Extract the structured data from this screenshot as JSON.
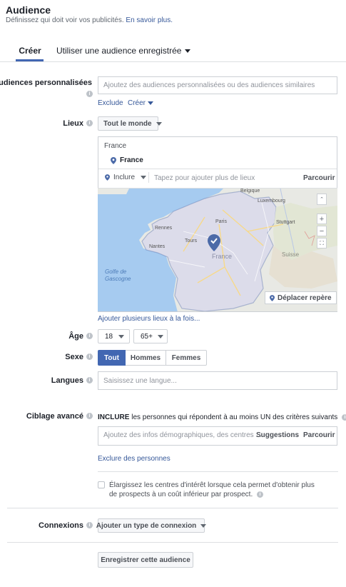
{
  "header": {
    "title": "Audience",
    "subtitle": "Définissez qui doit voir vos publicités.",
    "learn_more": "En savoir plus."
  },
  "tabs": [
    {
      "label": "Créer",
      "active": true
    },
    {
      "label": "Utiliser une audience enregistrée",
      "active": false
    }
  ],
  "custom_audiences": {
    "label": "Audiences personnalisées",
    "placeholder": "Ajoutez des audiences personnalisées ou des audiences similaires",
    "exclude": "Exclude",
    "create": "Créer"
  },
  "locations": {
    "label": "Lieux",
    "scope": "Tout le monde",
    "country_header": "France",
    "selected": "France",
    "include": "Inclure",
    "placeholder": "Tapez pour ajouter plus de lieux",
    "browse": "Parcourir",
    "move_pin": "Déplacer repère",
    "add_multiple": "Ajouter plusieurs lieux à la fois...",
    "map_labels": {
      "sea": "Golfe de\nGascogne",
      "country": "France",
      "city_paris": "Paris",
      "switzerland": "Suisse",
      "luxembourg": "Luxembourg",
      "stuttgart": "Stuttgart",
      "nantes": "Nantes",
      "tours": "Tours",
      "rennes": "Rennes",
      "belgique": "Belgique"
    }
  },
  "age": {
    "label": "Âge",
    "min": "18",
    "max": "65+",
    "dash": "-"
  },
  "gender": {
    "label": "Sexe",
    "options": [
      "Tout",
      "Hommes",
      "Femmes"
    ],
    "selected": "Tout"
  },
  "languages": {
    "label": "Langues",
    "placeholder": "Saisissez une langue..."
  },
  "detailed_targeting": {
    "label": "Ciblage avancé",
    "headline_bold": "INCLURE",
    "headline_rest": "les personnes qui répondent à au moins UN des critères suivants",
    "placeholder": "Ajoutez des infos démographiques, des centres ...",
    "suggestions": "Suggestions",
    "browse": "Parcourir",
    "exclude_people": "Exclure des personnes",
    "expand_text": "Élargissez les centres d'intérêt lorsque cela permet d'obtenir plus de prospects à un coût inférieur par prospect."
  },
  "connections": {
    "label": "Connexions",
    "button": "Ajouter un type de connexion"
  },
  "save_button": "Enregistrer cette audience",
  "colors": {
    "accent": "#4267b2",
    "link": "#365899",
    "water": "#a6cbf0",
    "land": "#e8e9e4"
  }
}
